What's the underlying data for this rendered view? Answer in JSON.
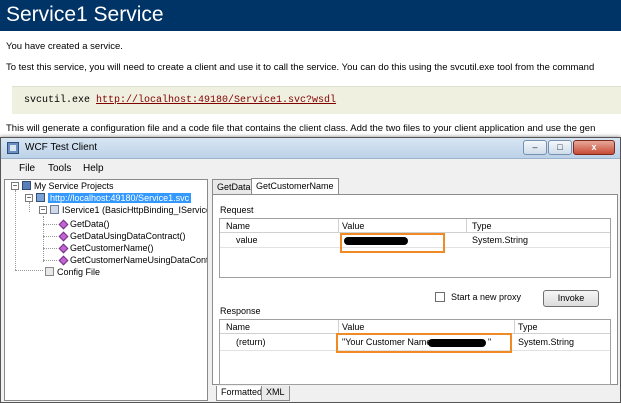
{
  "web_page": {
    "title": "Service1 Service",
    "intro": "You have created a service.",
    "instructions": "To test this service, you will need to create a client and use it to call the service. You can do this using the svcutil.exe tool from the command",
    "code_command": "svcutil.exe",
    "code_url": "http://localhost:49180/Service1.svc?wsdl",
    "followup": "This will generate a configuration file and a code file that contains the client class. Add the two files to your client application and use the gen"
  },
  "window": {
    "title": "WCF Test Client",
    "controls": {
      "minimize": "–",
      "maximize": "□",
      "close": "x"
    }
  },
  "menu": [
    "File",
    "Tools",
    "Help"
  ],
  "tree": {
    "root": "My Service Projects",
    "service_url": "http://localhost:49180/Service1.svc",
    "interface": "IService1 (BasicHttpBinding_IService",
    "methods": [
      "GetData()",
      "GetDataUsingDataContract()",
      "GetCustomerName()",
      "GetCustomerNameUsingDataCont"
    ],
    "config": "Config File"
  },
  "tabs": [
    "GetData",
    "GetCustomerName"
  ],
  "active_tab": "GetCustomerName",
  "request": {
    "label": "Request",
    "columns": [
      "Name",
      "Value",
      "Type"
    ],
    "rows": [
      {
        "name": "value",
        "value": "",
        "type": "System.String"
      }
    ]
  },
  "options": {
    "new_proxy_label": "Start a new proxy",
    "new_proxy_checked": false,
    "invoke_label": "Invoke"
  },
  "response": {
    "label": "Response",
    "columns": [
      "Name",
      "Value",
      "Type"
    ],
    "rows": [
      {
        "name": "(return)",
        "value_prefix": "\"Your Customer Name:",
        "value_suffix": "\"",
        "type": "System.String"
      }
    ]
  },
  "bottom_tabs": [
    "Formatted",
    "XML"
  ],
  "active_bottom_tab": "Formatted",
  "colors": {
    "header_bg": "#003366",
    "highlight": "#f08a24",
    "link": "#800000",
    "selection": "#3399ff"
  }
}
